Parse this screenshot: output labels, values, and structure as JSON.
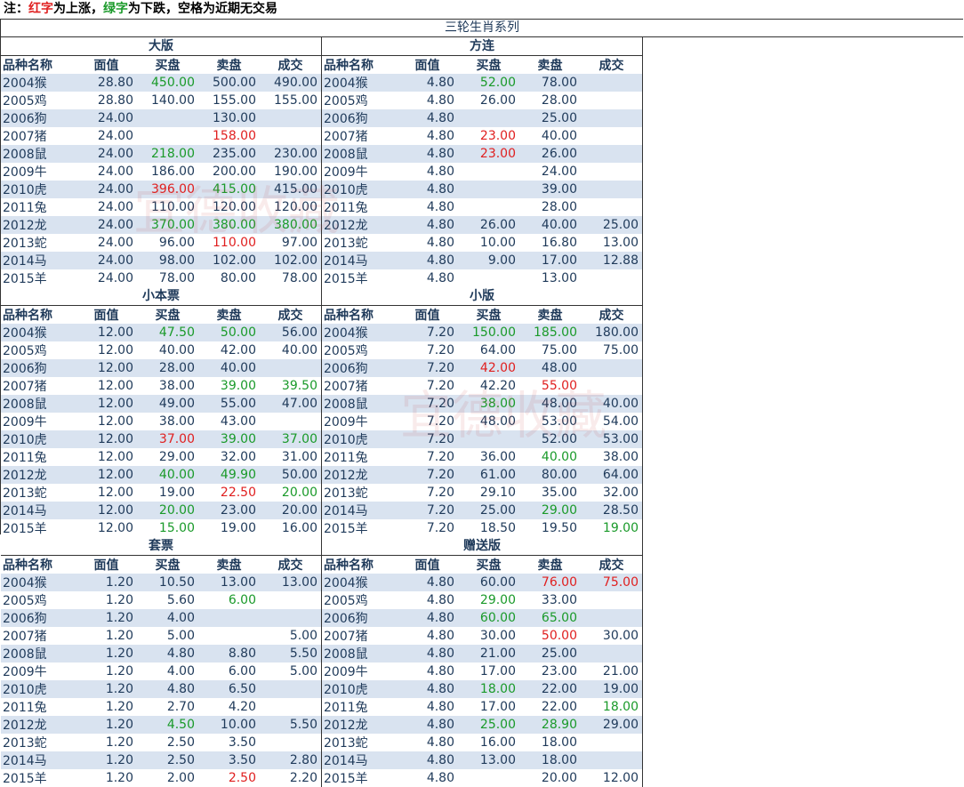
{
  "note": {
    "prefix": "注：",
    "red_word": "红字",
    "red_text": "为上涨，",
    "green_word": "绿字",
    "green_text": "为下跌，空格为近期无交易"
  },
  "title": "三轮生肖系列",
  "headers": [
    "品种名称",
    "面值",
    "买盘",
    "卖盘",
    "成交"
  ],
  "watermark_text": "宜德收藏",
  "colors": {
    "up": "#e02020",
    "down": "#1a9a2a",
    "stripe": "#d9e3f0",
    "text": "#1f3a5a"
  },
  "panels": [
    {
      "title": "大版",
      "rows": [
        [
          "2004猴",
          "28.80",
          "450.00|g",
          "500.00",
          "490.00"
        ],
        [
          "2005鸡",
          "28.80",
          "140.00",
          "155.00",
          "155.00"
        ],
        [
          "2006狗",
          "24.00",
          "",
          "130.00",
          ""
        ],
        [
          "2007猪",
          "24.00",
          "",
          "158.00|r",
          ""
        ],
        [
          "2008鼠",
          "24.00",
          "218.00|g",
          "235.00",
          "230.00"
        ],
        [
          "2009牛",
          "24.00",
          "186.00",
          "200.00",
          "190.00"
        ],
        [
          "2010虎",
          "24.00",
          "396.00|r",
          "415.00|g",
          "415.00"
        ],
        [
          "2011兔",
          "24.00",
          "110.00",
          "120.00",
          "120.00"
        ],
        [
          "2012龙",
          "24.00",
          "370.00|g",
          "380.00|g",
          "380.00|g"
        ],
        [
          "2013蛇",
          "24.00",
          "96.00",
          "110.00|r",
          "97.00"
        ],
        [
          "2014马",
          "24.00",
          "98.00",
          "102.00",
          "102.00"
        ],
        [
          "2015羊",
          "24.00",
          "78.00",
          "80.00",
          "78.00"
        ]
      ]
    },
    {
      "title": "方连",
      "rows": [
        [
          "2004猴",
          "4.80",
          "52.00|g",
          "78.00",
          ""
        ],
        [
          "2005鸡",
          "4.80",
          "26.00",
          "28.00",
          ""
        ],
        [
          "2006狗",
          "4.80",
          "",
          "25.00",
          ""
        ],
        [
          "2007猪",
          "4.80",
          "23.00|r",
          "40.00",
          ""
        ],
        [
          "2008鼠",
          "4.80",
          "23.00|r",
          "26.00",
          ""
        ],
        [
          "2009牛",
          "4.80",
          "",
          "24.00",
          ""
        ],
        [
          "2010虎",
          "4.80",
          "",
          "39.00",
          ""
        ],
        [
          "2011兔",
          "4.80",
          "",
          "28.00",
          ""
        ],
        [
          "2012龙",
          "4.80",
          "26.00",
          "40.00",
          "25.00"
        ],
        [
          "2013蛇",
          "4.80",
          "10.00",
          "16.80",
          "13.00"
        ],
        [
          "2014马",
          "4.80",
          "9.00",
          "17.00",
          "12.88"
        ],
        [
          "2015羊",
          "4.80",
          "",
          "13.00",
          ""
        ]
      ]
    },
    {
      "title": "小本票",
      "rows": [
        [
          "2004猴",
          "12.00",
          "47.50|g",
          "50.00|g",
          "56.00"
        ],
        [
          "2005鸡",
          "12.00",
          "40.00",
          "42.00",
          "40.00"
        ],
        [
          "2006狗",
          "12.00",
          "28.00",
          "40.00",
          ""
        ],
        [
          "2007猪",
          "12.00",
          "38.00",
          "39.00|g",
          "39.50|g"
        ],
        [
          "2008鼠",
          "12.00",
          "49.00",
          "55.00",
          "47.00"
        ],
        [
          "2009牛",
          "12.00",
          "38.00",
          "43.00",
          ""
        ],
        [
          "2010虎",
          "12.00",
          "37.00|r",
          "39.00|g",
          "37.00|g"
        ],
        [
          "2011兔",
          "12.00",
          "29.00",
          "32.00",
          "31.00"
        ],
        [
          "2012龙",
          "12.00",
          "40.00|g",
          "49.90|g",
          "50.00"
        ],
        [
          "2013蛇",
          "12.00",
          "19.00",
          "22.50|r",
          "20.00|g"
        ],
        [
          "2014马",
          "12.00",
          "20.00|g",
          "23.00",
          "20.00"
        ],
        [
          "2015羊",
          "12.00",
          "15.00|g",
          "19.00",
          "16.00"
        ]
      ]
    },
    {
      "title": "小版",
      "rows": [
        [
          "2004猴",
          "7.20",
          "150.00|g",
          "185.00|g",
          "180.00"
        ],
        [
          "2005鸡",
          "7.20",
          "64.00",
          "75.00",
          "75.00"
        ],
        [
          "2006狗",
          "7.20",
          "42.00|r",
          "48.00",
          ""
        ],
        [
          "2007猪",
          "7.20",
          "42.20",
          "55.00|r",
          ""
        ],
        [
          "2008鼠",
          "7.20",
          "38.00|g",
          "48.00",
          "40.00"
        ],
        [
          "2009牛",
          "7.20",
          "48.00",
          "53.00",
          "54.00"
        ],
        [
          "2010虎",
          "7.20",
          "",
          "52.00",
          "53.00"
        ],
        [
          "2011兔",
          "7.20",
          "36.00",
          "40.00|g",
          "38.00"
        ],
        [
          "2012龙",
          "7.20",
          "61.00",
          "80.00",
          "64.00"
        ],
        [
          "2013蛇",
          "7.20",
          "29.10",
          "35.00",
          "32.00"
        ],
        [
          "2014马",
          "7.20",
          "25.00",
          "29.00|g",
          "28.50"
        ],
        [
          "2015羊",
          "7.20",
          "18.50",
          "19.50",
          "19.00|g"
        ]
      ]
    },
    {
      "title": "套票",
      "rows": [
        [
          "2004猴",
          "1.20",
          "10.50",
          "13.00",
          "13.00"
        ],
        [
          "2005鸡",
          "1.20",
          "5.60",
          "6.00|g",
          ""
        ],
        [
          "2006狗",
          "1.20",
          "4.00",
          "",
          ""
        ],
        [
          "2007猪",
          "1.20",
          "5.00",
          "",
          "5.00"
        ],
        [
          "2008鼠",
          "1.20",
          "4.80",
          "8.80",
          "5.50"
        ],
        [
          "2009牛",
          "1.20",
          "4.00",
          "6.00",
          "5.00"
        ],
        [
          "2010虎",
          "1.20",
          "4.80",
          "6.50",
          ""
        ],
        [
          "2011兔",
          "1.20",
          "2.70",
          "4.20",
          ""
        ],
        [
          "2012龙",
          "1.20",
          "4.50|g",
          "10.00",
          "5.50"
        ],
        [
          "2013蛇",
          "1.20",
          "2.50",
          "3.50",
          ""
        ],
        [
          "2014马",
          "1.20",
          "2.50",
          "3.50",
          "2.80"
        ],
        [
          "2015羊",
          "1.20",
          "2.00",
          "2.50|r",
          "2.20"
        ]
      ]
    },
    {
      "title": "赠送版",
      "rows": [
        [
          "2004猴",
          "4.80",
          "60.00",
          "76.00|r",
          "75.00|r"
        ],
        [
          "2005鸡",
          "4.80",
          "29.00|g",
          "33.00",
          ""
        ],
        [
          "2006狗",
          "4.80",
          "60.00|g",
          "65.00|g",
          ""
        ],
        [
          "2007猪",
          "4.80",
          "30.00",
          "50.00|r",
          "30.00"
        ],
        [
          "2008鼠",
          "4.80",
          "21.00",
          "25.00",
          ""
        ],
        [
          "2009牛",
          "4.80",
          "17.00",
          "23.00",
          "21.00"
        ],
        [
          "2010虎",
          "4.80",
          "18.00|g",
          "22.00",
          "19.00"
        ],
        [
          "2011兔",
          "4.80",
          "17.00",
          "22.00",
          "18.00|g"
        ],
        [
          "2012龙",
          "4.80",
          "25.00|g",
          "28.90|g",
          "29.00"
        ],
        [
          "2013蛇",
          "4.80",
          "16.00",
          "18.00",
          ""
        ],
        [
          "2014马",
          "4.80",
          "13.00",
          "18.00",
          ""
        ],
        [
          "2015羊",
          "4.80",
          "",
          "20.00",
          "12.00"
        ]
      ]
    }
  ]
}
